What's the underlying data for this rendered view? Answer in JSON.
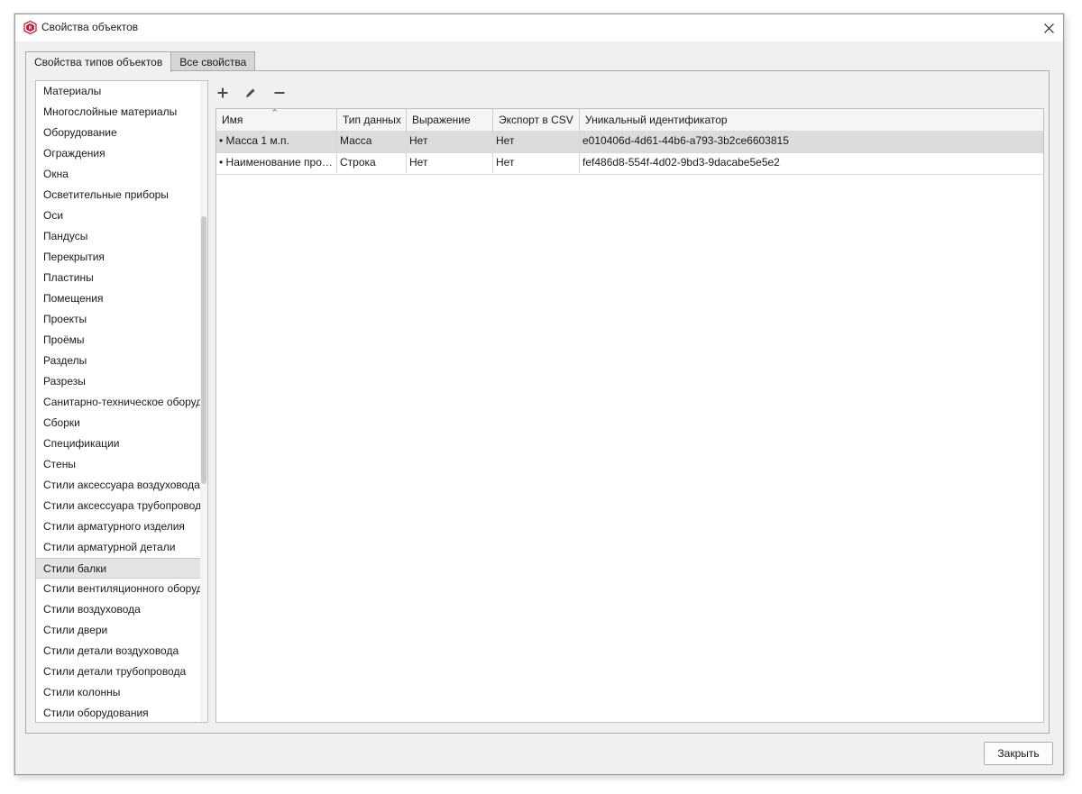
{
  "window": {
    "title": "Свойства объектов",
    "icon": "app-logo-icon",
    "close_icon": "close-icon"
  },
  "tabs": [
    {
      "label": "Свойства типов объектов",
      "active": true
    },
    {
      "label": "Все свойства",
      "active": false
    }
  ],
  "object_types": [
    {
      "label": "Материалы",
      "selected": false
    },
    {
      "label": "Многослойные материалы",
      "selected": false
    },
    {
      "label": "Оборудование",
      "selected": false
    },
    {
      "label": "Ограждения",
      "selected": false
    },
    {
      "label": "Окна",
      "selected": false
    },
    {
      "label": "Осветительные приборы",
      "selected": false
    },
    {
      "label": "Оси",
      "selected": false
    },
    {
      "label": "Пандусы",
      "selected": false
    },
    {
      "label": "Перекрытия",
      "selected": false
    },
    {
      "label": "Пластины",
      "selected": false
    },
    {
      "label": "Помещения",
      "selected": false
    },
    {
      "label": "Проекты",
      "selected": false
    },
    {
      "label": "Проёмы",
      "selected": false
    },
    {
      "label": "Разделы",
      "selected": false
    },
    {
      "label": "Разрезы",
      "selected": false
    },
    {
      "label": "Санитарно-техническое оборудование",
      "selected": false
    },
    {
      "label": "Сборки",
      "selected": false
    },
    {
      "label": "Спецификации",
      "selected": false
    },
    {
      "label": "Стены",
      "selected": false
    },
    {
      "label": "Стили аксессуара воздуховода",
      "selected": false
    },
    {
      "label": "Стили аксессуара трубопровода",
      "selected": false
    },
    {
      "label": "Стили арматурного изделия",
      "selected": false
    },
    {
      "label": "Стили арматурной детали",
      "selected": false
    },
    {
      "label": "Стили балки",
      "selected": true
    },
    {
      "label": "Стили вентиляционного оборудования",
      "selected": false
    },
    {
      "label": "Стили воздуховода",
      "selected": false
    },
    {
      "label": "Стили двери",
      "selected": false
    },
    {
      "label": "Стили детали воздуховода",
      "selected": false
    },
    {
      "label": "Стили детали трубопровода",
      "selected": false
    },
    {
      "label": "Стили колонны",
      "selected": false
    },
    {
      "label": "Стили оборудования",
      "selected": false
    }
  ],
  "toolbar": {
    "add_icon": "plus-icon",
    "edit_icon": "pencil-icon",
    "remove_icon": "minus-icon"
  },
  "table": {
    "columns": [
      "Имя",
      "Тип данных",
      "Выражение",
      "Экспорт в CSV",
      "Уникальный идентификатор"
    ],
    "sort_icon": "sort-ascending-icon",
    "rows": [
      {
        "name": "• Масса 1 м.п.",
        "type": "Масса",
        "expression": "Нет",
        "export": "Нет",
        "id": "e010406d-4d61-44b6-a793-3b2ce6603815",
        "selected": true
      },
      {
        "name": "• Наименование про…",
        "type": "Строка",
        "expression": "Нет",
        "export": "Нет",
        "id": "fef486d8-554f-4d02-9bd3-9dacabe5e5e2",
        "selected": false
      }
    ]
  },
  "footer": {
    "close_label": "Закрыть"
  },
  "colors": {
    "accent": "#c8102e",
    "selection": "#dcdcdc",
    "dialog_bg": "#f0f0f0"
  }
}
